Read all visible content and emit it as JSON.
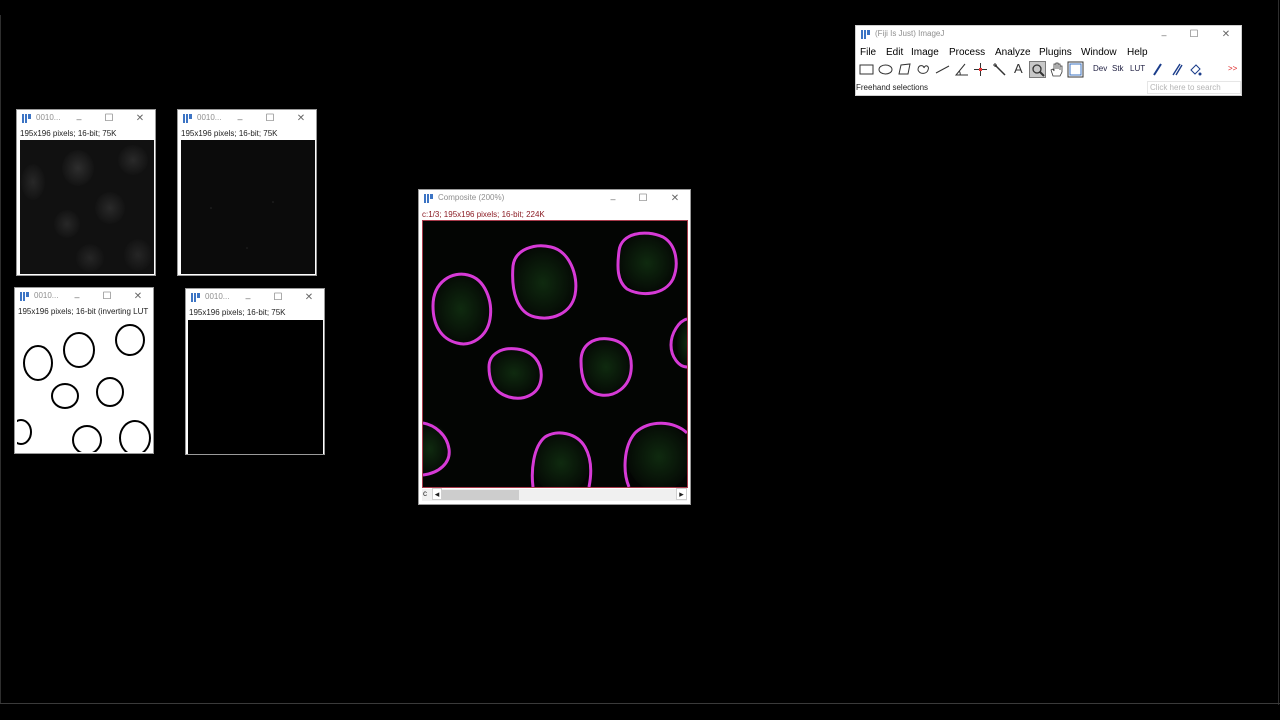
{
  "imagej": {
    "title": "(Fiji Is Just) ImageJ",
    "menus": [
      "File",
      "Edit",
      "Image",
      "Process",
      "Analyze",
      "Plugins",
      "Window",
      "Help"
    ],
    "tools": [
      {
        "name": "rectangle-tool-icon",
        "label": ""
      },
      {
        "name": "oval-tool-icon",
        "label": ""
      },
      {
        "name": "polygon-tool-icon",
        "label": ""
      },
      {
        "name": "freehand-tool-icon",
        "label": ""
      },
      {
        "name": "line-tool-icon",
        "label": ""
      },
      {
        "name": "angle-tool-icon",
        "label": ""
      },
      {
        "name": "point-tool-icon",
        "label": ""
      },
      {
        "name": "wand-tool-icon",
        "label": ""
      },
      {
        "name": "text-tool-icon",
        "label": "A"
      },
      {
        "name": "magnifier-tool-icon",
        "label": ""
      },
      {
        "name": "hand-tool-icon",
        "label": ""
      },
      {
        "name": "color-picker-tool-icon",
        "label": ""
      },
      {
        "name": "dev-menu-icon",
        "label": "Dev"
      },
      {
        "name": "stk-menu-icon",
        "label": "Stk"
      },
      {
        "name": "lut-menu-icon",
        "label": "LUT"
      },
      {
        "name": "pencil-tool-icon",
        "label": ""
      },
      {
        "name": "brush-tool-icon",
        "label": ""
      },
      {
        "name": "flood-fill-tool-icon",
        "label": ""
      },
      {
        "name": "more-tools-icon",
        "label": ">>"
      }
    ],
    "status": "Freehand selections",
    "search_placeholder": "Click here to search"
  },
  "windows": [
    {
      "title": "0010...",
      "info": "195x196 pixels; 16-bit; 75K"
    },
    {
      "title": "0010...",
      "info": "195x196 pixels; 16-bit; 75K"
    },
    {
      "title": "0010...",
      "info": "195x196 pixels; 16-bit (inverting LUT"
    },
    {
      "title": "0010...",
      "info": "195x196 pixels; 16-bit; 75K"
    }
  ],
  "composite": {
    "title": "Composite (200%)",
    "info": "c:1/3; 195x196 pixels; 16-bit; 224K",
    "channel_label": "c",
    "channel_position": 0.33,
    "colors": {
      "outline": "#d63ad6",
      "info_text": "#8b1c24",
      "nuclei": "#0f2a0f"
    }
  },
  "controls": {
    "minimize": "–",
    "maximize": "☐",
    "close": "✕",
    "scroll_left": "◂",
    "scroll_right": "▸"
  }
}
